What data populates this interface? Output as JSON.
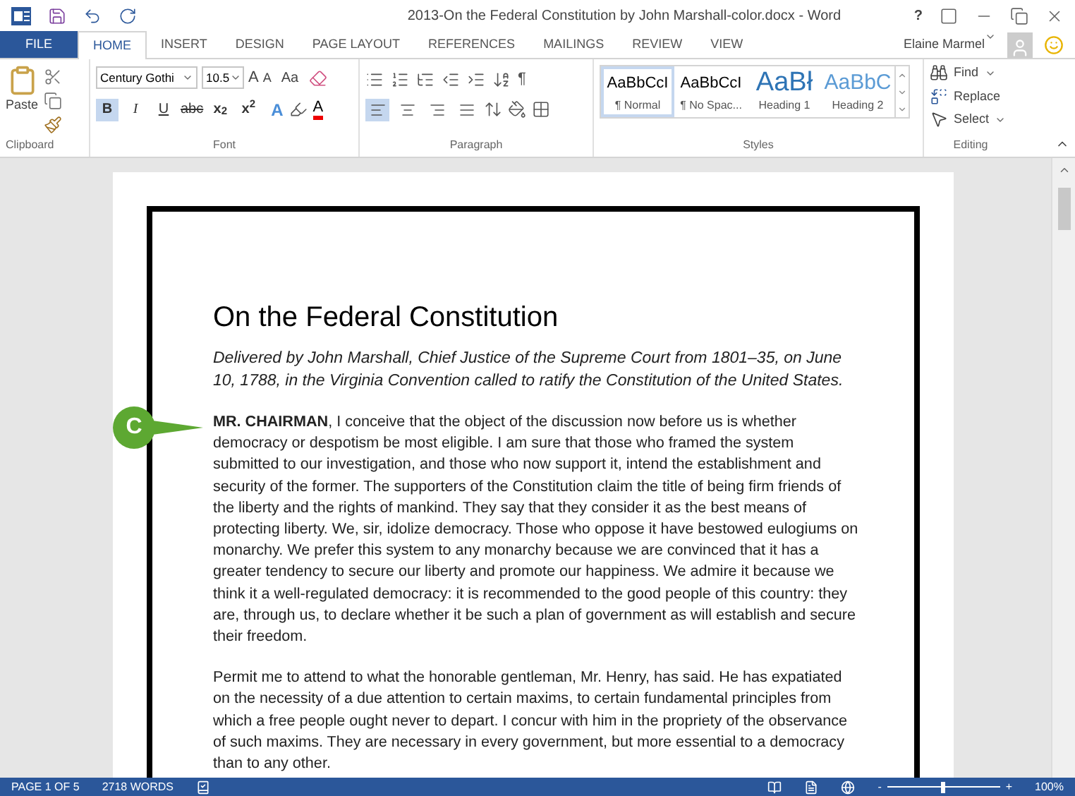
{
  "window": {
    "title": "2013-On the Federal Constitution by John Marshall-color.docx - Word",
    "help": "?"
  },
  "tabs": [
    {
      "label": "FILE",
      "kind": "file",
      "selected": false
    },
    {
      "label": "HOME",
      "kind": "tab",
      "selected": true
    },
    {
      "label": "INSERT",
      "kind": "tab",
      "selected": false
    },
    {
      "label": "DESIGN",
      "kind": "tab",
      "selected": false
    },
    {
      "label": "PAGE LAYOUT",
      "kind": "tab",
      "selected": false
    },
    {
      "label": "REFERENCES",
      "kind": "tab",
      "selected": false
    },
    {
      "label": "MAILINGS",
      "kind": "tab",
      "selected": false
    },
    {
      "label": "REVIEW",
      "kind": "tab",
      "selected": false
    },
    {
      "label": "VIEW",
      "kind": "tab",
      "selected": false
    }
  ],
  "user": {
    "name": "Elaine Marmel"
  },
  "ribbon": {
    "clipboard": {
      "paste": "Paste",
      "label": "Clipboard"
    },
    "font": {
      "label": "Font",
      "name": "Century Gothi",
      "size": "10.5",
      "grow": "A",
      "shrink": "A",
      "change_case": "Aa",
      "text_effects": "A",
      "font_color": "A",
      "format_buttons": [
        {
          "label": "B",
          "kind": "bold",
          "selected": true
        },
        {
          "label": "I",
          "kind": "italic",
          "selected": false
        },
        {
          "label": "U",
          "kind": "underline",
          "selected": false
        },
        {
          "label": "abc",
          "kind": "strike",
          "selected": false
        },
        {
          "label": "x$_{2}$",
          "kind": "sub",
          "selected": false
        },
        {
          "label": "x$^{2}$",
          "kind": "sup",
          "selected": false
        }
      ]
    },
    "paragraph": {
      "label": "Paragraph",
      "pilcrow": "¶",
      "align_buttons": [
        {
          "kind": "left",
          "selected": true
        },
        {
          "kind": "center",
          "selected": false
        },
        {
          "kind": "right",
          "selected": false
        },
        {
          "kind": "justify",
          "selected": false
        }
      ]
    },
    "styles": {
      "label": "Styles",
      "items": [
        {
          "preview": "AaBbCcI",
          "name": "¶ Normal",
          "kind": "body",
          "selected": true
        },
        {
          "preview": "AaBbCcI",
          "name": "¶ No Spac...",
          "kind": "body",
          "selected": false
        },
        {
          "preview": "AaBł",
          "name": "Heading 1",
          "kind": "h1",
          "selected": false
        },
        {
          "preview": "AaBbC",
          "name": "Heading 2",
          "kind": "h2",
          "selected": false
        }
      ]
    },
    "editing": {
      "label": "Editing",
      "find": "Find",
      "replace": "Replace",
      "select": "Select"
    }
  },
  "document": {
    "title": "On the Federal Constitution",
    "subtitle": "Delivered by John Marshall, Chief Justice of the Supreme Court from 1801–35, on June 10, 1788, in the Virginia Convention called to ratify the Constitution of the United States.",
    "paragraphs": [
      "**MR. CHAIRMAN**, I conceive that the object of the discussion now before us is whether democracy or despotism be most eligible. I am sure that those who framed the system submitted to our investigation, and those who now support it, intend the establishment and security of the former. The supporters of the Constitution claim the title of being firm friends of the liberty and the rights of mankind. They say that they consider it as the best means of protecting liberty. We, sir, idolize democracy. Those who oppose it have bestowed eulogiums on monarchy. We prefer this system to any monarchy because we are convinced that it has a greater tendency to secure our liberty and promote our happiness. We admire it because we think it a well-regulated democracy: it is recommended to the good people of this country: they are, through us, to declare whether it be such a plan of government as will establish and secure their freedom.",
      "Permit me to attend to what the honorable gentleman, Mr. Henry, has said. He has expatiated on the necessity of a due attention to certain maxims, to certain fundamental principles from which a free people ought never to depart. I concur with him in the propriety of the observance of such maxims. They are necessary in every government, but more essential to a democracy than to any other."
    ],
    "callout": "C"
  },
  "status_bar": {
    "page": "PAGE 1 OF 5",
    "words": "2718 WORDS",
    "zoom_out": "-",
    "zoom_in": "+",
    "zoom": "100%",
    "zoom_slider": {
      "level": 0.5
    }
  }
}
